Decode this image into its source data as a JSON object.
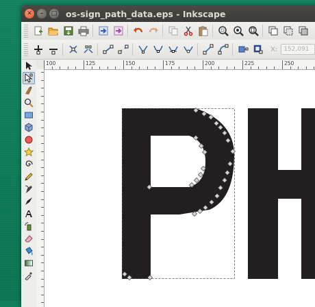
{
  "window": {
    "title": "os-sign_path_data.eps - Inkscape"
  },
  "toolbar_main": [
    "new-icon",
    "open-icon",
    "save-icon",
    "print-icon",
    "import-icon",
    "export-icon",
    "undo-icon",
    "redo-icon",
    "copy-icon",
    "cut-icon",
    "paste-icon",
    "zoom-selection-icon",
    "zoom-drawing-icon",
    "zoom-page-icon",
    "duplicate-icon",
    "clone-icon",
    "unlink-clone-icon"
  ],
  "toolbar_ctrl": [
    "add-node-icon",
    "delete-node-icon",
    "join-nodes-icon",
    "break-path-icon",
    "join-segment-icon",
    "delete-segment-icon",
    "cusp-node-icon",
    "smooth-node-icon",
    "symmetric-node-icon",
    "auto-smooth-icon",
    "line-segment-icon",
    "curve-segment-icon",
    "object-to-path-icon",
    "stroke-to-path-icon"
  ],
  "x_field": {
    "label": "X:",
    "value": "152,091"
  },
  "ruler_top": [
    "100",
    "125",
    "150",
    "175",
    "200",
    "225",
    "250"
  ],
  "tools": [
    "selector-tool-icon",
    "node-tool-icon",
    "tweak-tool-icon",
    "zoom-tool-icon",
    "rect-tool-icon",
    "3d-box-tool-icon",
    "ellipse-tool-icon",
    "star-tool-icon",
    "spiral-tool-icon",
    "pencil-tool-icon",
    "pen-tool-icon",
    "calligraphy-tool-icon",
    "text-tool-icon",
    "spray-tool-icon",
    "eraser-tool-icon",
    "bucket-tool-icon",
    "gradient-tool-icon",
    "dropper-tool-icon"
  ],
  "active_tool": "node-tool-icon",
  "canvas": {
    "fill_color": "#231f20",
    "letters": "PH"
  }
}
